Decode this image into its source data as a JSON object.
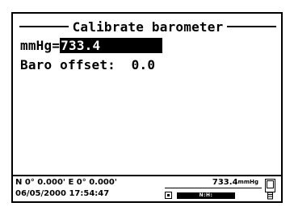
{
  "screen": {
    "title": "Calibrate barometer",
    "baro_field": {
      "label": "mmHg=",
      "value": "733.4"
    },
    "offset_field": {
      "label": "Baro offset:",
      "value": "0.0"
    }
  },
  "status_bar": {
    "gps": "N 0° 0.000' E 0° 0.000'",
    "datetime": "06/05/2000 17:54:47",
    "baro_reading": "733.4",
    "baro_unit": "mmHg",
    "level_label": "N:H:",
    "icons": [
      "battery-icon",
      "device-icon"
    ]
  }
}
